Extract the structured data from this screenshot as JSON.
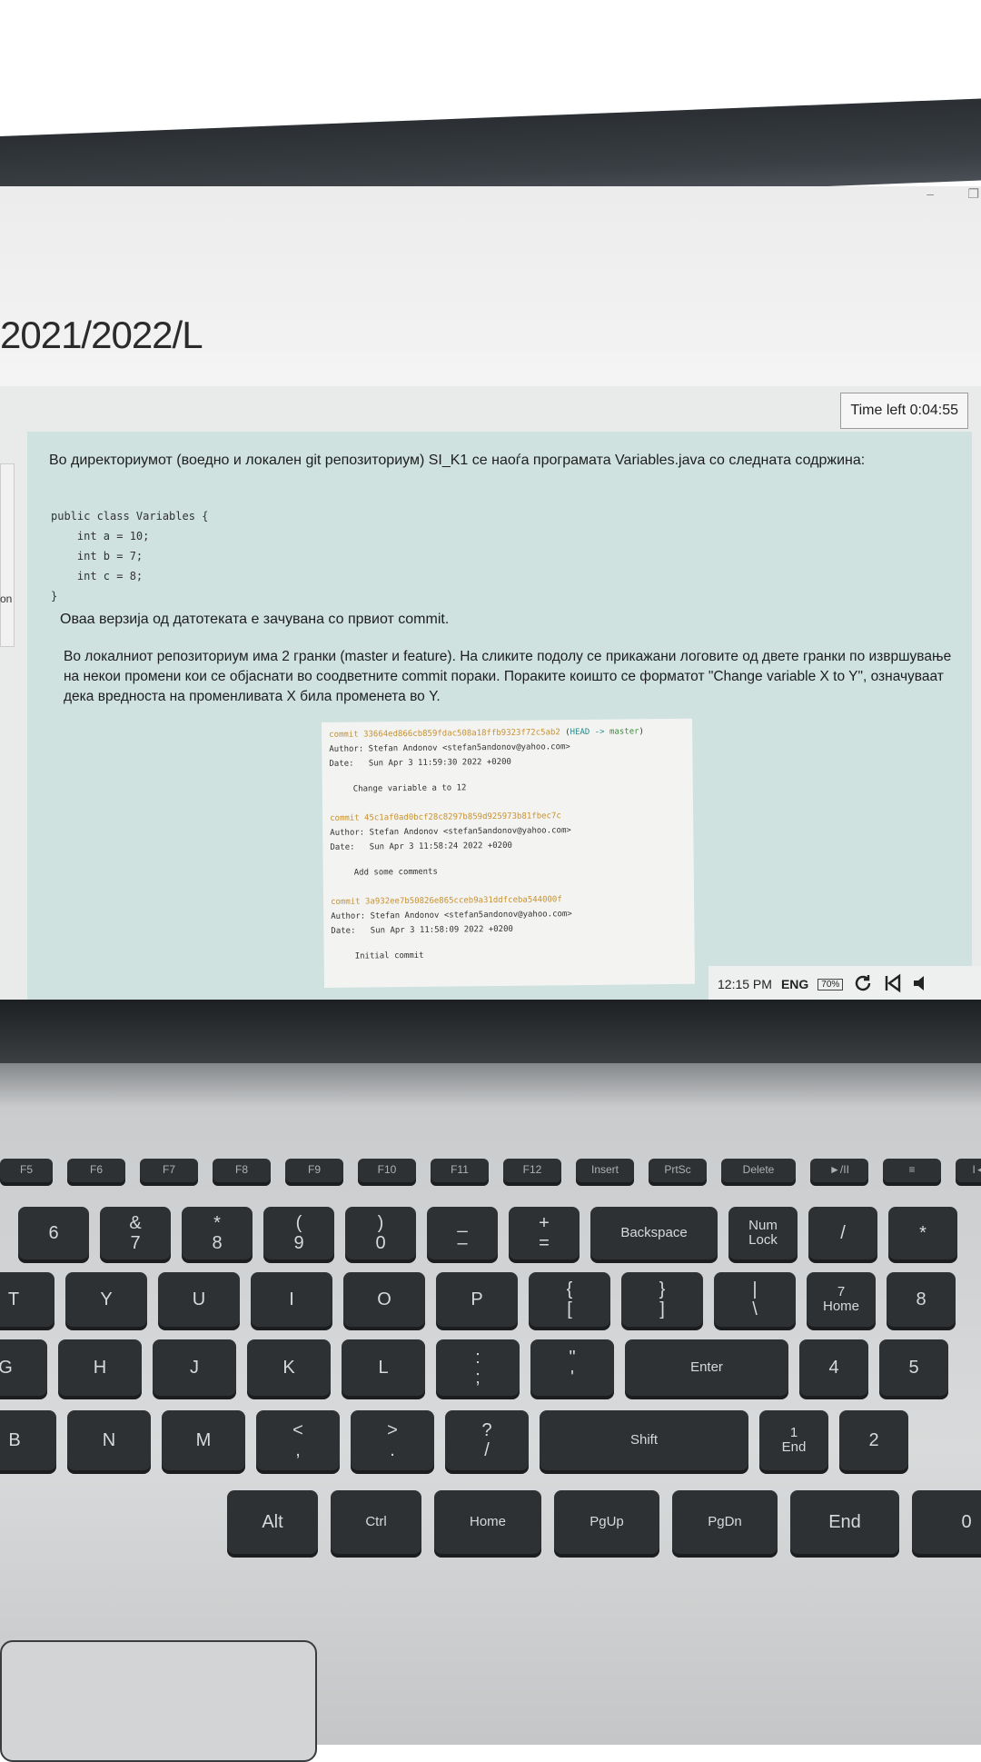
{
  "window": {
    "minimize_glyph": "–",
    "restore_glyph": "❐"
  },
  "header": {
    "title": "2021/2022/L"
  },
  "timer": {
    "label": "Time left 0:04:55"
  },
  "left_rail": {
    "text": "on"
  },
  "question": {
    "intro": "Во директориумот (воедно и локален git репозиториум) SI_K1 се наоѓа програмата Variables.java со следната содржина:",
    "code_lines": [
      "public class Variables {",
      "    int a = 10;",
      "    int b = 7;",
      "    int c = 8;",
      "}"
    ],
    "para1": "Оваа верзија од датотеката е зачувана со првиот commit.",
    "para2": "Во локалниот репозиториум има 2 гранки (master и feature). На сликите подолу се прикажани логовите од двете гранки по извршување на некои промени кои се објаснати во соодветните commit пораки. Пораките коишто се форматот \"Change variable X to Y\", означуваат дека вредноста на променливата X била променета во Y."
  },
  "git_log": {
    "commits": [
      {
        "hash": "commit 33664ed866cb859fdac508a18ffb9323f72c5ab2",
        "refs_head": "HEAD ->",
        "refs_branch": "master",
        "author": "Author: Stefan Andonov <stefan5andonov@yahoo.com>",
        "date": "Date:   Sun Apr 3 11:59:30 2022 +0200",
        "message": "Change variable a to 12"
      },
      {
        "hash": "commit 45c1af0ad0bcf28c8297b859d925973b81fbec7c",
        "author": "Author: Stefan Andonov <stefan5andonov@yahoo.com>",
        "date": "Date:   Sun Apr 3 11:58:24 2022 +0200",
        "message": "Add some comments"
      },
      {
        "hash": "commit 3a932ee7b50826e865cceb9a31ddfceba544000f",
        "author": "Author: Stefan Andonov <stefan5andonov@yahoo.com>",
        "date": "Date:   Sun Apr 3 11:58:09 2022 +0200",
        "message": "Initial commit"
      }
    ]
  },
  "taskbar": {
    "time": "12:15 PM",
    "language": "ENG",
    "battery": "70%",
    "refresh_icon": "refresh-icon",
    "prev_icon": "skip-back-icon",
    "volume_icon": "volume-icon"
  },
  "keyboard": {
    "fn_row": [
      "F5",
      "F6",
      "F7",
      "F8",
      "F9",
      "F10",
      "F11",
      "F12",
      "Insert",
      "PrtSc",
      "Delete",
      "►/II",
      "≡",
      "I◄◄"
    ],
    "number_row": [
      "6",
      "&\n7",
      "*\n8",
      "(\n9",
      ")\n0",
      "_\n–",
      "+\n=",
      "Backspace",
      "Num\nLock",
      "/",
      "*"
    ],
    "top_row": [
      "T",
      "Y",
      "U",
      "I",
      "O",
      "P",
      "{\n[",
      "}\n]",
      "|\n\\",
      "7\nHome",
      "8"
    ],
    "home_row": [
      "G",
      "H",
      "J",
      "K",
      "L",
      ":\n;",
      "\"\n'",
      "Enter",
      "4",
      "5"
    ],
    "bottom_row": [
      "B",
      "N",
      "M",
      "<\n,",
      ">\n.",
      "?\n/",
      "Shift",
      "1\nEnd",
      "2"
    ],
    "space_row": [
      "Alt",
      "Ctrl",
      "Home",
      "PgUp",
      "PgDn",
      "End",
      "0"
    ]
  }
}
